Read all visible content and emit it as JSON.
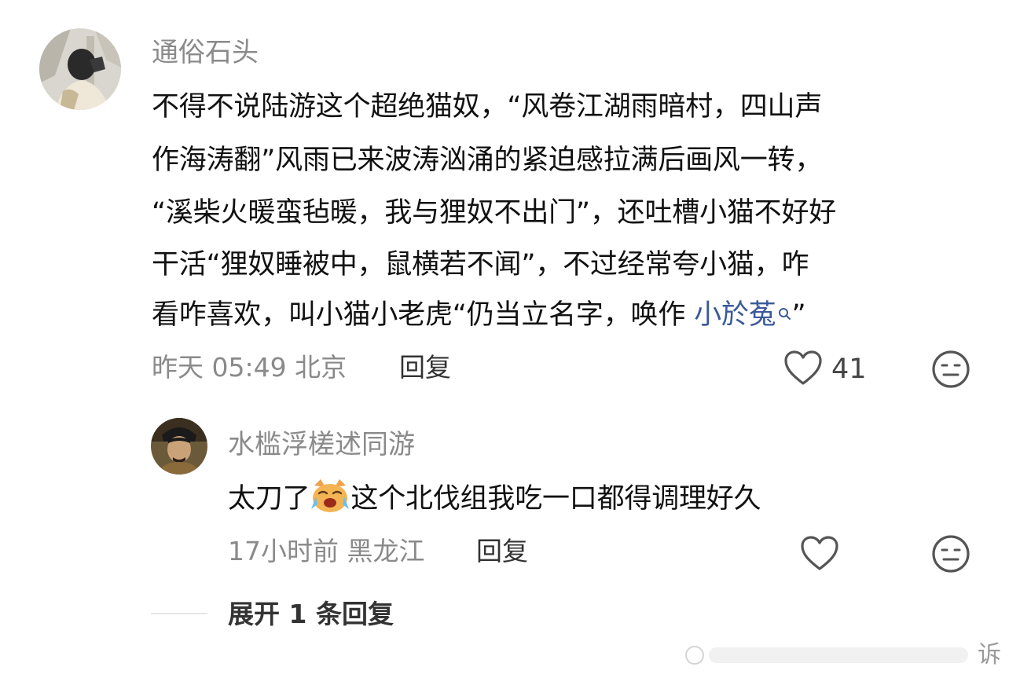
{
  "comment": {
    "username": "通俗石头",
    "lines": [
      "不得不说陆游这个超绝猫奴，“风卷江湖雨暗村，四山声",
      "作海涛翻”风雨已来波涛汹涌的紧迫感拉满后画风一转，",
      "“溪柴火暖蛮毡暖，我与狸奴不出门”，还吐槽小猫不好好",
      "干活“狸奴睡被中，鼠横若不闻”，不过经常夸小猫，咋",
      "看咋喜欢，叫小猫小老虎“仍当立名字，唤作"
    ],
    "link_text": "小於菟",
    "closing_quote": "”",
    "time_location": "昨天 05:49 北京",
    "reply_label": "回复",
    "like_count": "41"
  },
  "reply": {
    "username": "水槛浮槎述同游",
    "text_before": "太刀了",
    "text_after": "这个北伐组我吃一口都得调理好久",
    "time_location": "17小时前 黑龙江",
    "reply_label": "回复"
  },
  "expand_label": "展开 1 条回复",
  "watermark_text": "诉",
  "colors": {
    "username": "#8a8a8a",
    "body_text": "#111111",
    "link": "#3a5a9a",
    "meta": "#8a8a8a",
    "divider": "#e6e6e6"
  },
  "icons": {
    "like": "heart-outline-icon",
    "emoji": "neutral-face-icon",
    "link": "search-icon",
    "inline_emoji": "crying-cat-emoji"
  }
}
